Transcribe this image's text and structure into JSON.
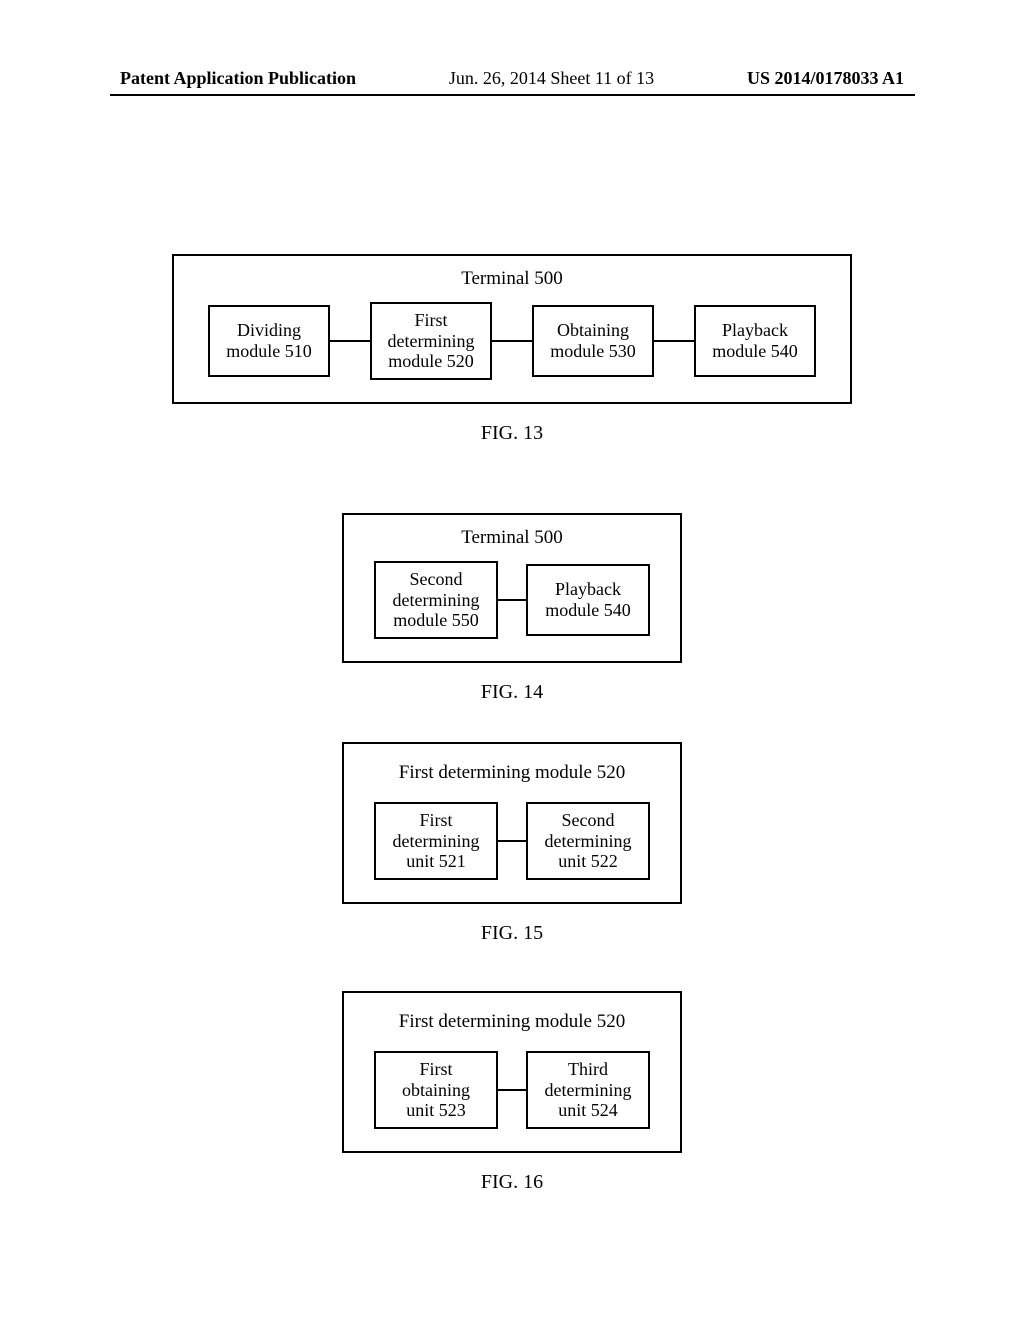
{
  "header": {
    "left": "Patent Application Publication",
    "center": "Jun. 26, 2014  Sheet 11 of 13",
    "right": "US 2014/0178033 A1"
  },
  "fig13": {
    "caption": "FIG. 13",
    "title": "Terminal 500",
    "box1_l1": "Dividing",
    "box1_l2": "module 510",
    "box2_l1": "First",
    "box2_l2": "determining",
    "box2_l3": "module 520",
    "box3_l1": "Obtaining",
    "box3_l2": "module 530",
    "box4_l1": "Playback",
    "box4_l2": "module 540"
  },
  "fig14": {
    "caption": "FIG. 14",
    "title": "Terminal 500",
    "box1_l1": "Second",
    "box1_l2": "determining",
    "box1_l3": "module 550",
    "box2_l1": "Playback",
    "box2_l2": "module 540"
  },
  "fig15": {
    "caption": "FIG. 15",
    "title": "First determining module  520",
    "box1_l1": "First",
    "box1_l2": "determining",
    "box1_l3": "unit 521",
    "box2_l1": "Second",
    "box2_l2": "determining",
    "box2_l3": "unit 522"
  },
  "fig16": {
    "caption": "FIG. 16",
    "title": "First determining module 520",
    "box1_l1": "First",
    "box1_l2": "obtaining",
    "box1_l3": "unit 523",
    "box2_l1": "Third",
    "box2_l2": "determining",
    "box2_l3": "unit 524"
  }
}
